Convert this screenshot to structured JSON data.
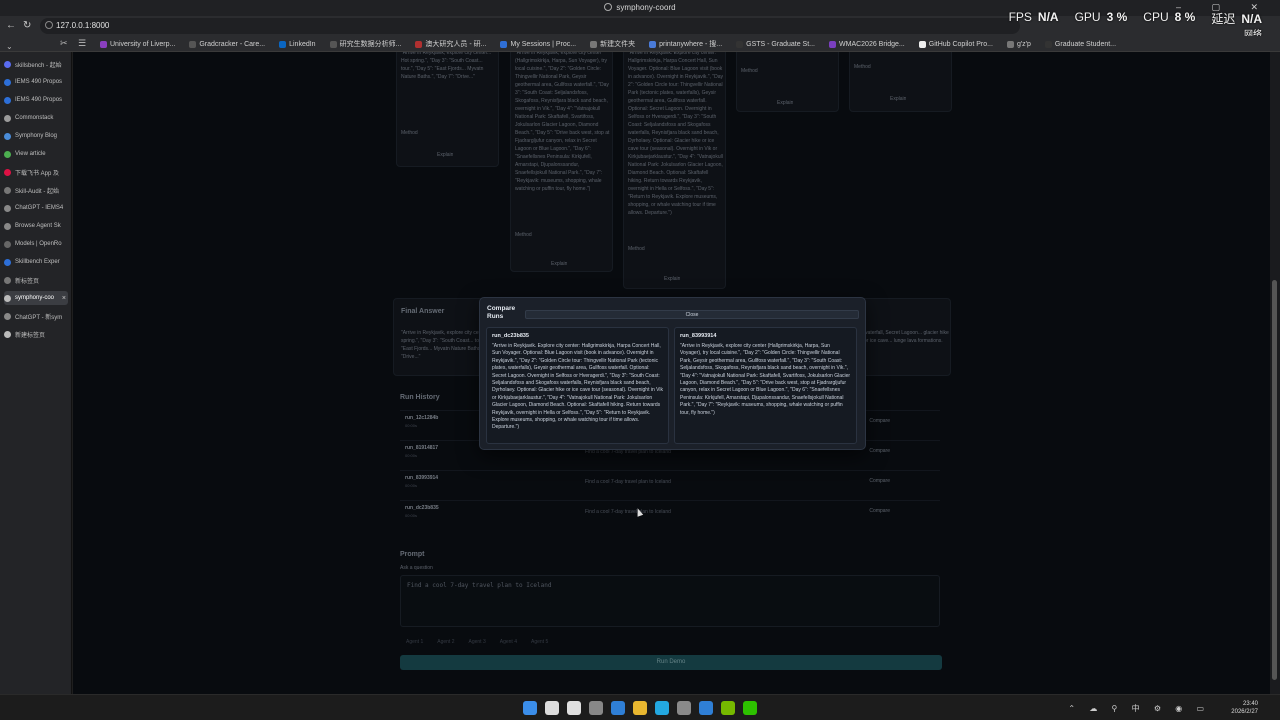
{
  "browser": {
    "tab_title": "symphony-coord",
    "url": "127.0.0.1:8000",
    "window_controls": "– ▢ ✕"
  },
  "stats_overlay": {
    "fps_label": "FPS",
    "fps_value": "N/A",
    "gpu_label": "GPU",
    "gpu_value": "3 %",
    "cpu_label": "CPU",
    "cpu_value": "8 %",
    "latency_label": "延迟",
    "latency_value": "N/A",
    "net_label": "网络"
  },
  "bookmarks": [
    {
      "label": "University of Liverp...",
      "color": "#8a3fbf"
    },
    {
      "label": "Gradcracker - Care...",
      "color": "#555"
    },
    {
      "label": "LinkedIn",
      "color": "#0a66c2"
    },
    {
      "label": "研究生数据分析师...",
      "color": "#555"
    },
    {
      "label": "澳大研究人员 - 研...",
      "color": "#b03030"
    },
    {
      "label": "My Sessions | Proc...",
      "color": "#2f6fd6"
    },
    {
      "label": "新建文件夹",
      "color": "#777"
    },
    {
      "label": "printanywhere - 搜...",
      "color": "#4a7bd8"
    },
    {
      "label": "GSTS - Graduate St...",
      "color": "#333"
    },
    {
      "label": "WMAC2026 Bridge...",
      "color": "#7a3fbf"
    },
    {
      "label": "GitHub Copilot Pro...",
      "color": "#eee"
    },
    {
      "label": "g'z'p",
      "color": "#777"
    },
    {
      "label": "Graduate Student...",
      "color": "#333"
    }
  ],
  "sidebar_tabs": [
    {
      "label": "skillsbench - 起始",
      "color": "#5a6cf0"
    },
    {
      "label": "IEMS 490 Propos",
      "color": "#2d6fd8"
    },
    {
      "label": "IEMS 490 Propos",
      "color": "#2d6fd8"
    },
    {
      "label": "Commonstack",
      "color": "#9b9b9b"
    },
    {
      "label": "Symphony Blog",
      "color": "#4a8cd8"
    },
    {
      "label": "View article",
      "color": "#4caf50"
    },
    {
      "label": "下载飞书 App 及",
      "color": "#d14"
    },
    {
      "label": "Skill-Audit - 起始",
      "color": "#777"
    },
    {
      "label": "ChatGPT - IEMS4",
      "color": "#888"
    },
    {
      "label": "Browse Agent Sk",
      "color": "#888"
    },
    {
      "label": "Models | OpenRo",
      "color": "#666"
    },
    {
      "label": "Skillbench Exper",
      "color": "#2d6fd8"
    },
    {
      "label": "新标签页",
      "color": "#777"
    },
    {
      "label": "symphony-coo",
      "color": "#bbb",
      "active": true
    },
    {
      "label": "ChatGPT - 新sym",
      "color": "#888"
    },
    {
      "label": "新建标签页",
      "color": "#bbb"
    }
  ],
  "background": {
    "final_answer_title": "Final Answer",
    "final_answer_text": "\"Arrive in Reykjavik, explore city center... Hot spring.\", \"Day 3\": \"South Coast... tour.\", \"Day 5\": \"East Fjords... Myvatn Nature Baths.\", \"Day 7\": \"Drive...\"",
    "final_answer_right": "waterfall, Secret Lagoon... glacier hike or ice cave... lunge lava formations.",
    "method_label": "Method",
    "explain_label": "Explain",
    "run_history_title": "Run History",
    "runs": [
      {
        "id": "run_12c1284b",
        "sub": "00:00s",
        "prompt": "Find a cool 7-day travel plan to Iceland",
        "action": "Compare"
      },
      {
        "id": "run_81914817",
        "sub": "00:00s",
        "prompt": "Find a cool 7-day travel plan to Iceland",
        "action": "Compare"
      },
      {
        "id": "run_83993914",
        "sub": "00:00s",
        "prompt": "Find a cool 7-day travel plan to Iceland",
        "action": "Compare"
      },
      {
        "id": "run_dc23b835",
        "sub": "00:00s",
        "prompt": "Find a cool 7-day travel plan to Iceland",
        "action": "Compare"
      }
    ],
    "prompt_title": "Prompt",
    "prompt_hint": "Ask a question",
    "prompt_value": "Find a cool 7-day travel plan to Iceland",
    "chips": [
      "Agent 1",
      "Agent 2",
      "Agent 3",
      "Agent 4",
      "Agent 5"
    ],
    "run_demo_label": "Run Demo"
  },
  "modal": {
    "title": "Compare Runs",
    "close_label": "Close",
    "left": {
      "id": "run_dc23b835",
      "body": "\"Arrive in Reykjavik. Explore city center: Hallgrimskirkja, Harpa Concert Hall, Sun Voyager. Optional: Blue Lagoon visit (book in advance). Overnight in Reykjavik.\", \"Day 2\": \"Golden Circle tour: Thingvellir National Park (tectonic plates, waterfalls), Geysir geothermal area, Gullfoss waterfall. Optional: Secret Lagoon. Overnight in Selfoss or Hveragerdi.\", \"Day 3\": \"South Coast: Seljalandsfoss and Skogafoss waterfalls, Reynisfjara black sand beach, Dyrholaey. Optional: Glacier hike or ice cave tour (seasonal). Overnight in Vik or Kirkjubaejarklaustur.\", \"Day 4\": \"Vatnajokull National Park: Jokulsarlon Glacier Lagoon, Diamond Beach. Optional: Skaftafell hiking. Return towards Reykjavik, overnight in Hella or Selfoss.\", \"Day 5\": \"Return to Reykjavik. Explore museums, shopping, or whale watching tour if time allows. Departure.\")"
    },
    "right": {
      "id": "run_83993914",
      "body": "\"Arrive in Reykjavik, explore city center (Hallgrimskirkja, Harpa, Sun Voyager), try local cuisine.\", \"Day 2\": \"Golden Circle: Thingvellir National Park, Geysir geothermal area, Gullfoss waterfall.\", \"Day 3\": \"South Coast: Seljalandsfoss, Skogafoss, Reynisfjara black sand beach, overnight in Vik.\", \"Day 4\": \"Vatnajokull National Park: Skaftafell, Svartifoss, Jokulsarlon Glacier Lagoon, Diamond Beach.\", \"Day 5\": \"Drive back west, stop at Fjadrargljufur canyon, relax in Secret Lagoon or Blue Lagoon.\", \"Day 6\": \"Snaefellsnes Peninsula: Kirkjufell, Arnarstapi, Djupalonssandur, Snaefellsjokull National Park.\", \"Day 7\": \"Reykjavik: museums, shopping, whale watching or puffin tour, fly home.\")"
    }
  },
  "taskbar": {
    "clock_time": "23:40",
    "clock_date": "2026/2/27",
    "tray_icons": "⌃ ☁ ⚲ 中 ⚙ ◉ ▭",
    "app_colors": [
      "#3b8eea",
      "#ddd",
      "#e0e0e0",
      "#888",
      "#2f7fd6",
      "#e8b730",
      "#23a8e0",
      "#8a8a8a",
      "#2f7fd6",
      "#76b900",
      "#2dc100"
    ]
  }
}
